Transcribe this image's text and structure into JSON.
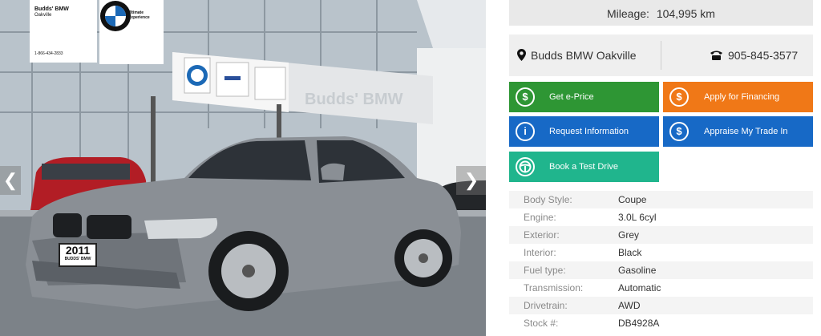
{
  "photo": {
    "dealer_card": {
      "name": "Budds' BMW",
      "sub": "Oakville",
      "phone": "1-866-434-2833"
    },
    "bmw_card": {
      "tagline_1": "The Ultimate",
      "tagline_2": "Driving Experience"
    },
    "building_sign": "Budds' BMW",
    "plate": {
      "year": "2011",
      "dealer": "BUDDS' BMW"
    },
    "prev_icon": "chevron-left-icon",
    "next_icon": "chevron-right-icon"
  },
  "mileage": {
    "label": "Mileage:",
    "value": "104,995 km"
  },
  "contact": {
    "location_icon": "map-pin-icon",
    "dealer": "Budds BMW Oakville",
    "phone_icon": "phone-icon",
    "phone": "905-845-3577"
  },
  "actions": [
    {
      "label": "Get e-Price",
      "icon": "dollar-circle-icon",
      "color": "#2e9634"
    },
    {
      "label": "Apply for Financing",
      "icon": "dollar-circle-icon",
      "color": "#f07817"
    },
    {
      "label": "Request Information",
      "icon": "info-circle-icon",
      "color": "#1769c6"
    },
    {
      "label": "Appraise My Trade In",
      "icon": "dollar-circle-icon",
      "color": "#1769c6"
    },
    {
      "label": "Book a Test Drive",
      "icon": "steering-wheel-icon",
      "color": "#20b58d"
    }
  ],
  "specs": [
    {
      "label": "Body Style:",
      "value": "Coupe"
    },
    {
      "label": "Engine:",
      "value": "3.0L 6cyl"
    },
    {
      "label": "Exterior:",
      "value": "Grey"
    },
    {
      "label": "Interior:",
      "value": "Black"
    },
    {
      "label": "Fuel type:",
      "value": "Gasoline"
    },
    {
      "label": "Transmission:",
      "value": "Automatic"
    },
    {
      "label": "Drivetrain:",
      "value": "AWD"
    },
    {
      "label": "Stock #:",
      "value": "DB4928A"
    }
  ]
}
